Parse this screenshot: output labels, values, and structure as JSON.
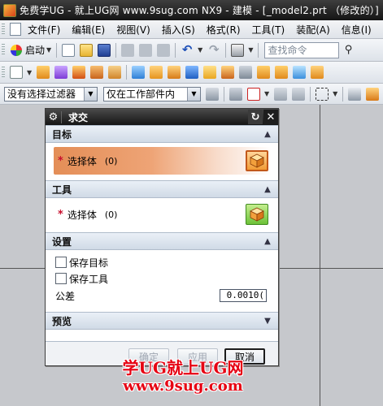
{
  "window": {
    "title": "免费学UG - 就上UG网 www.9sug.com   NX9 - 建模 - [_model2.prt （修改的）]"
  },
  "menu": [
    "文件(F)",
    "编辑(E)",
    "视图(V)",
    "插入(S)",
    "格式(R)",
    "工具(T)",
    "装配(A)",
    "信息(I)"
  ],
  "toolbar": {
    "start_label": "启动",
    "search_placeholder": "查找命令"
  },
  "selection_bar": {
    "filter": "没有选择过滤器",
    "scope": "仅在工作部件内"
  },
  "dialog": {
    "title": "求交",
    "target": {
      "header": "目标",
      "label": "选择体",
      "count": "(0)"
    },
    "tool": {
      "header": "工具",
      "label": "选择体",
      "count": "(0)"
    },
    "settings": {
      "header": "设置",
      "keep_target": "保存目标",
      "keep_tool": "保存工具",
      "tolerance_label": "公差",
      "tolerance_value": "0.0010("
    },
    "preview": {
      "header": "预览"
    },
    "buttons": {
      "ok": "确定",
      "apply": "应用",
      "cancel": "取消"
    }
  },
  "watermark": {
    "line1": "学UG就上UG网",
    "line2": "www.9sug.com"
  },
  "colors": {
    "accent_orange": "#e48e57",
    "title_dark": "#1e1e1e",
    "watermark_red": "#e60012"
  }
}
